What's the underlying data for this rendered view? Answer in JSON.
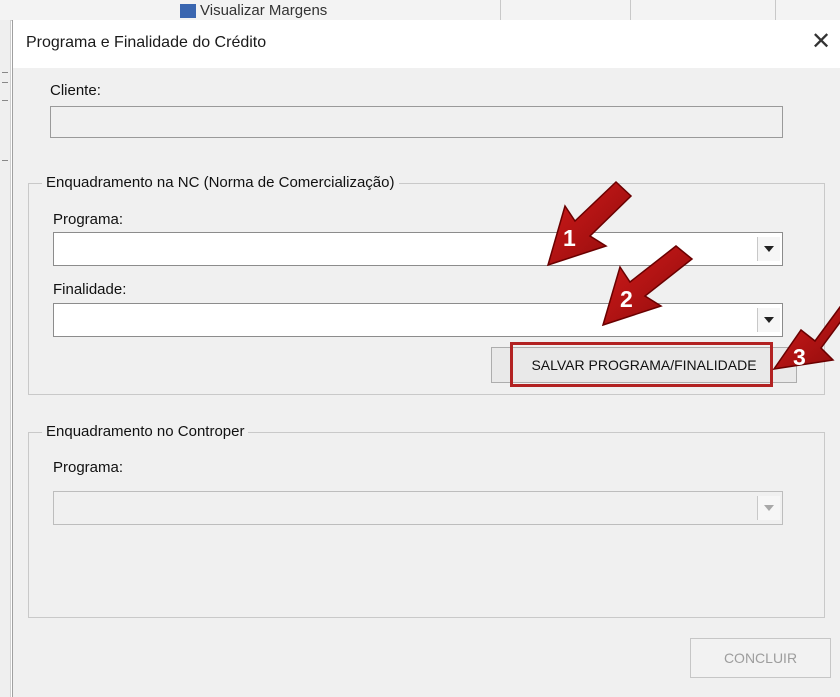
{
  "background": {
    "menu_item_label": "Visualizar Margens"
  },
  "dialog": {
    "title": "Programa e Finalidade do Crédito",
    "close_glyph": "✕",
    "cliente": {
      "label": "Cliente:",
      "value": ""
    },
    "nc_group": {
      "legend": "Enquadramento na NC (Norma de Comercialização)",
      "programa_label": "Programa:",
      "programa_value": "",
      "finalidade_label": "Finalidade:",
      "finalidade_value": "",
      "save_button_label": "SALVAR PROGRAMA/FINALIDADE"
    },
    "controper_group": {
      "legend": "Enquadramento no Controper",
      "programa_label": "Programa:",
      "programa_value": ""
    },
    "concluir_button_label": "CONCLUIR"
  },
  "annotations": {
    "arrow_color": "#b01010",
    "highlight_color": "#b22222",
    "steps": [
      "1",
      "2",
      "3"
    ]
  }
}
